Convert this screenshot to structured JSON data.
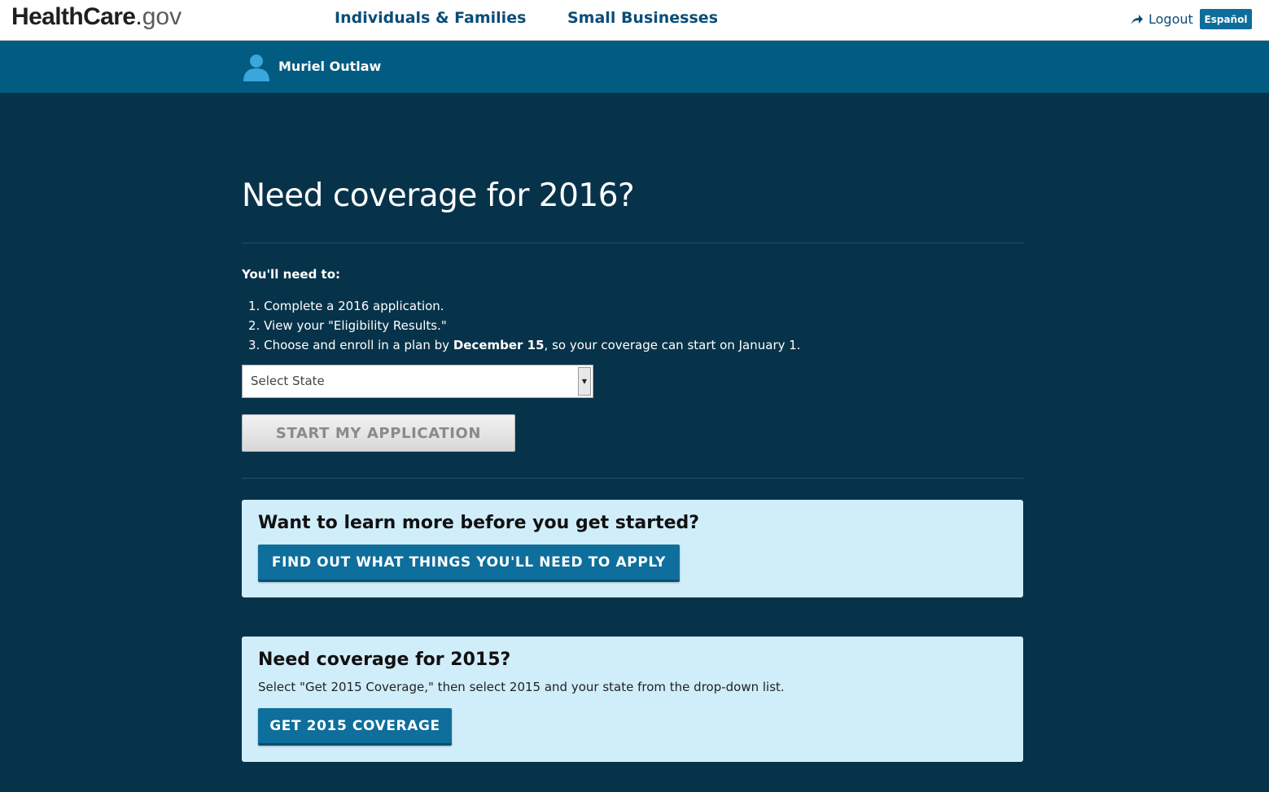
{
  "header": {
    "logo": {
      "main": "HealthCare",
      "dot": ".",
      "suffix": "gov"
    },
    "nav": {
      "individuals": "Individuals & Families",
      "small_business": "Small Businesses"
    },
    "logout_label": "Logout",
    "language_label": "Español"
  },
  "user": {
    "name": "Muriel Outlaw"
  },
  "main": {
    "title": "Need coverage for 2016?",
    "need_label": "You'll need to:",
    "steps": {
      "s1": "Complete a 2016 application.",
      "s2": "View your \"Eligibility Results.\"",
      "s3_pre": "Choose and enroll in a plan by ",
      "s3_bold": "December 15",
      "s3_post": ", so your coverage can start on January 1."
    },
    "state_select": {
      "selected": "Select State"
    },
    "start_button": "START MY APPLICATION"
  },
  "learn_card": {
    "title": "Want to learn more before you get started?",
    "button": "FIND OUT WHAT THINGS YOU'LL NEED TO APPLY"
  },
  "coverage_2015_card": {
    "title": "Need coverage for 2015?",
    "text": "Select \"Get 2015 Coverage,\" then select 2015 and your state from the drop-down list.",
    "button": "GET 2015 COVERAGE"
  },
  "colors": {
    "page_bg": "#07334a",
    "userbar_bg": "#025b80",
    "nav_text": "#0b4d78",
    "accent_button": "#0e6e9c",
    "card_bg": "#d0edfa"
  }
}
